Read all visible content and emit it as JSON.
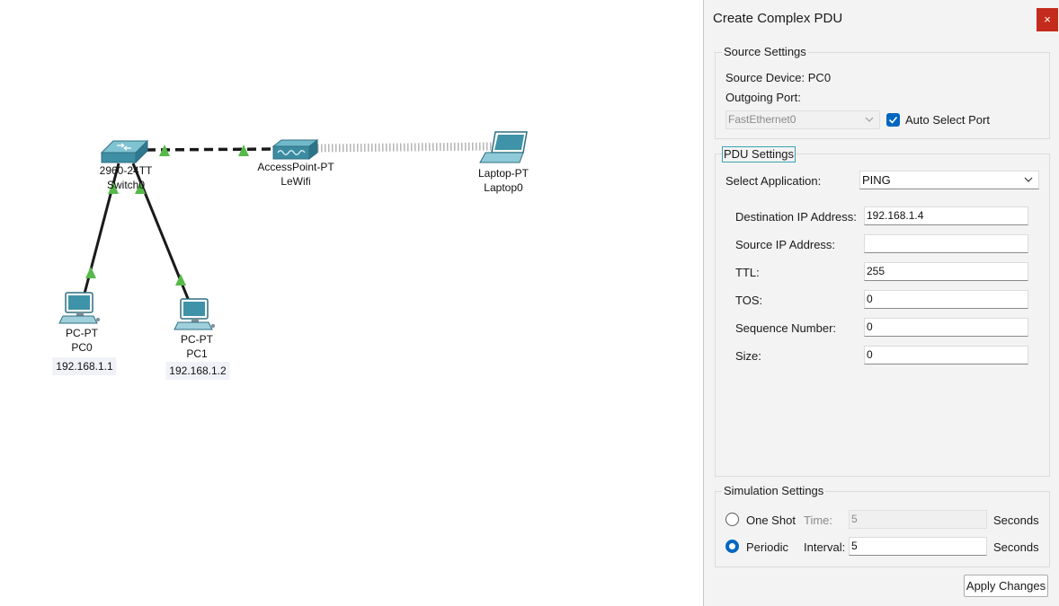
{
  "topology": {
    "switch": {
      "model": "2960-24TT",
      "name": "Switch0"
    },
    "access_point": {
      "model": "AccessPoint-PT",
      "name": "LeWifi"
    },
    "laptop": {
      "model": "Laptop-PT",
      "name": "Laptop0"
    },
    "pc0": {
      "model": "PC-PT",
      "name": "PC0",
      "ip": "192.168.1.1"
    },
    "pc1": {
      "model": "PC-PT",
      "name": "PC1",
      "ip": "192.168.1.2"
    },
    "link_color": "#1a1a1a",
    "link_up_color": "#56b94a"
  },
  "dialog": {
    "title": "Create Complex PDU",
    "close": "×",
    "source": {
      "legend": "Source Settings",
      "device": "Source Device: PC0",
      "port_label": "Outgoing Port:",
      "port_value": "FastEthernet0",
      "auto_select": "Auto Select Port"
    },
    "pdu": {
      "legend": "PDU Settings",
      "app_label": "Select Application:",
      "app_value": "PING",
      "dest_ip_label": "Destination IP Address:",
      "dest_ip": "192.168.1.4",
      "src_ip_label": "Source IP Address:",
      "src_ip": "",
      "ttl_label": "TTL:",
      "ttl": "255",
      "tos_label": "TOS:",
      "tos": "0",
      "seq_label": "Sequence Number:",
      "seq": "0",
      "size_label": "Size:",
      "size": "0"
    },
    "simulation": {
      "legend": "Simulation Settings",
      "one_shot": "One Shot",
      "time_label": "Time:",
      "time_value": "5",
      "time_unit": "Seconds",
      "periodic": "Periodic",
      "interval_label": "Interval:",
      "interval_value": "5",
      "interval_unit": "Seconds",
      "selected": "Periodic"
    },
    "apply": "Apply Changes",
    "accent": "#0067c0"
  }
}
